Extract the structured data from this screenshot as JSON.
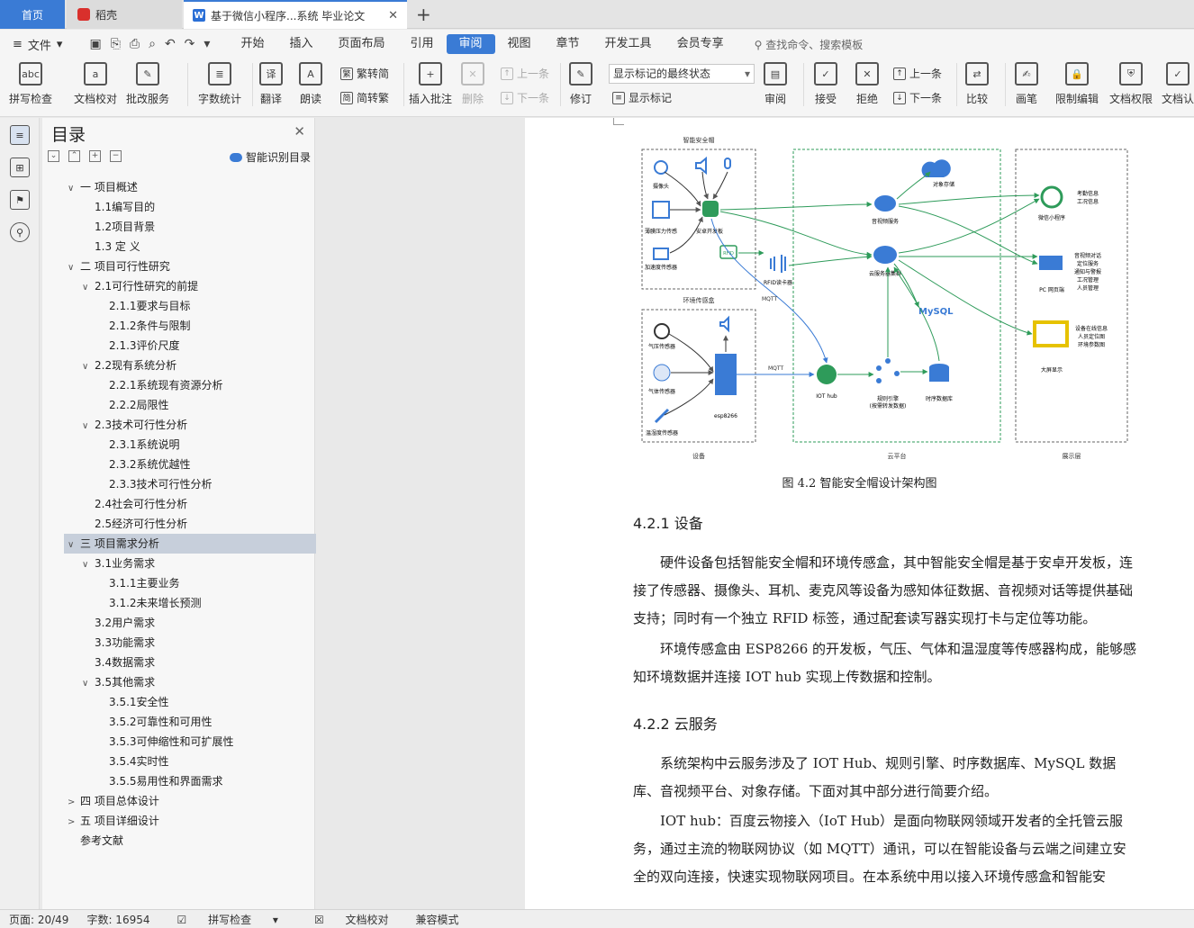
{
  "tabs": {
    "home": "首页",
    "daoke": "稻壳",
    "doc": "基于微信小程序...系统 毕业论文"
  },
  "menu": {
    "file": "文件",
    "items": [
      "开始",
      "插入",
      "页面布局",
      "引用",
      "审阅",
      "视图",
      "章节",
      "开发工具",
      "会员专享"
    ],
    "active": "审阅",
    "search": "查找命令、搜索模板"
  },
  "ribbon": {
    "spell": "拼写检查",
    "proof": "文档校对",
    "review_service": "批改服务",
    "wordcount": "字数统计",
    "translate": "翻译",
    "read": "朗读",
    "trad": "繁转简",
    "simp": "简转繁",
    "insert_comment": "插入批注",
    "delete": "删除",
    "prev_c": "上一条",
    "next_c": "下一条",
    "revise": "修订",
    "markup_select": "显示标记的最终状态",
    "show_markup": "显示标记",
    "review": "审阅",
    "accept": "接受",
    "reject": "拒绝",
    "prev": "上一条",
    "next": "下一条",
    "compare": "比较",
    "pen": "画笔",
    "restrict": "限制编辑",
    "permission": "文档权限",
    "cert": "文档认"
  },
  "toc": {
    "title": "目录",
    "smart": "智能识别目录",
    "items": [
      {
        "level": 1,
        "tw": "∨",
        "text": "一 项目概述"
      },
      {
        "level": 2,
        "tw": "",
        "text": "1.1编写目的"
      },
      {
        "level": 2,
        "tw": "",
        "text": "1.2项目背景"
      },
      {
        "level": 2,
        "tw": "",
        "text": "1.3 定 义"
      },
      {
        "level": 1,
        "tw": "∨",
        "text": "二 项目可行性研究"
      },
      {
        "level": 2,
        "tw": "∨",
        "text": "2.1可行性研究的前提"
      },
      {
        "level": 3,
        "tw": "",
        "text": "2.1.1要求与目标"
      },
      {
        "level": 3,
        "tw": "",
        "text": "2.1.2条件与限制"
      },
      {
        "level": 3,
        "tw": "",
        "text": "2.1.3评价尺度"
      },
      {
        "level": 2,
        "tw": "∨",
        "text": "2.2现有系统分析"
      },
      {
        "level": 3,
        "tw": "",
        "text": "2.2.1系统现有资源分析"
      },
      {
        "level": 3,
        "tw": "",
        "text": "2.2.2局限性"
      },
      {
        "level": 2,
        "tw": "∨",
        "text": "2.3技术可行性分析"
      },
      {
        "level": 3,
        "tw": "",
        "text": "2.3.1系统说明"
      },
      {
        "level": 3,
        "tw": "",
        "text": "2.3.2系统优越性"
      },
      {
        "level": 3,
        "tw": "",
        "text": "2.3.3技术可行性分析"
      },
      {
        "level": 2,
        "tw": "",
        "text": "2.4社会可行性分析"
      },
      {
        "level": 2,
        "tw": "",
        "text": "2.5经济可行性分析"
      },
      {
        "level": 1,
        "tw": "∨",
        "text": "三 项目需求分析",
        "selected": true
      },
      {
        "level": 2,
        "tw": "∨",
        "text": "3.1业务需求"
      },
      {
        "level": 3,
        "tw": "",
        "text": "3.1.1主要业务"
      },
      {
        "level": 3,
        "tw": "",
        "text": "3.1.2未来增长预测"
      },
      {
        "level": 2,
        "tw": "",
        "text": "3.2用户需求"
      },
      {
        "level": 2,
        "tw": "",
        "text": "3.3功能需求"
      },
      {
        "level": 2,
        "tw": "",
        "text": "3.4数据需求"
      },
      {
        "level": 2,
        "tw": "∨",
        "text": "3.5其他需求"
      },
      {
        "level": 3,
        "tw": "",
        "text": "3.5.1安全性"
      },
      {
        "level": 3,
        "tw": "",
        "text": "3.5.2可靠性和可用性"
      },
      {
        "level": 3,
        "tw": "",
        "text": "3.5.3可伸缩性和可扩展性"
      },
      {
        "level": 3,
        "tw": "",
        "text": "3.5.4实时性"
      },
      {
        "level": 3,
        "tw": "",
        "text": "3.5.5易用性和界面需求"
      },
      {
        "level": 1,
        "tw": ">",
        "text": "四 项目总体设计"
      },
      {
        "level": 1,
        "tw": ">",
        "text": "五 项目详细设计"
      },
      {
        "level": 1,
        "tw": "",
        "text": "参考文献"
      }
    ]
  },
  "diagram": {
    "helmet": "智能安全帽",
    "env_box": "环境传感盒",
    "camera": "摄像头",
    "pressure": "薄膜压力传感",
    "accel": "加速度传感器",
    "android": "安卓开发板",
    "rfid": "RFID读卡器",
    "rfid_tag": "RFID",
    "mqtt1": "MQTT",
    "mqtt2": "MQTT",
    "baro": "气压传感器",
    "gas": "气体传感器",
    "humid": "温湿度传感器",
    "esp": "esp8266",
    "obj_store": "对象存储",
    "av_service": "音视频服务",
    "cloud_cluster": "云服务器集群",
    "mysql": "MySQL",
    "iothub": "IOT hub",
    "rule1": "规则引擎",
    "rule2": "(按需转发数据)",
    "tsdb": "时序数据库",
    "wx": "微信小程序",
    "wx_note1": "考勤信息",
    "wx_note2": "工况信息",
    "pc": "PC 网页端",
    "pc_notes": [
      "音视频对话",
      "定位服务",
      "通知与警报",
      "工况管理",
      "人员管理"
    ],
    "screen": "大屏显示",
    "screen_notes": [
      "设备在线信息",
      "人员定位图",
      "环境参数图"
    ],
    "zone_device": "设备",
    "zone_cloud": "云平台",
    "zone_display": "展示层"
  },
  "doc": {
    "caption": "图 4.2 智能安全帽设计架构图",
    "h_421": "4.2.1 设备",
    "p1": "硬件设备包括智能安全帽和环境传感盒，其中智能安全帽是基于安卓开发板，连接了传感器、摄像头、耳机、麦克风等设备为感知体征数据、音视频对话等提供基础支持；同时有一个独立 RFID 标签，通过配套读写器实现打卡与定位等功能。",
    "p2": "环境传感盒由 ESP8266 的开发板，气压、气体和温湿度等传感器构成，能够感知环境数据并连接 IOT hub 实现上传数据和控制。",
    "h_422": "4.2.2 云服务",
    "p3": "系统架构中云服务涉及了 IOT Hub、规则引擎、时序数据库、MySQL 数据库、音视频平台、对象存储。下面对其中部分进行简要介绍。",
    "p4": "IOT hub：百度云物接入（IoT Hub）是面向物联网领域开发者的全托管云服务，通过主流的物联网协议（如 MQTT）通讯，可以在智能设备与云端之间建立安全的双向连接，快速实现物联网项目。在本系统中用以接入环境传感盒和智能安"
  },
  "status": {
    "page": "页面: 20/49",
    "words": "字数: 16954",
    "spell": "拼写检查",
    "proof": "文档校对",
    "compat": "兼容模式"
  },
  "colors": {
    "accent": "#3a7bd5",
    "diagram_green": "#2e9b5a",
    "diagram_blue": "#3a7bd5"
  }
}
